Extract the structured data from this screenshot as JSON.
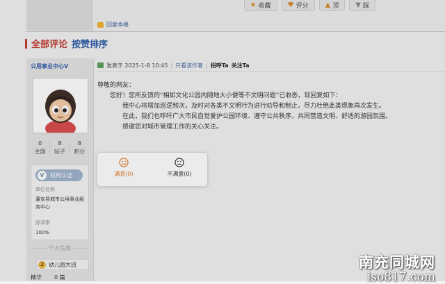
{
  "toolbar": {
    "favorite": "收藏",
    "rate": "评分",
    "up": "顶",
    "down": "踩",
    "reply_this_floor": "回复本楼"
  },
  "section": {
    "all_comments": "全部评论",
    "sort_by_likes": "按赞排序"
  },
  "user": {
    "name": "公用事业中心V",
    "stats": [
      {
        "value": "0",
        "label": "主题"
      },
      {
        "value": "8",
        "label": "帖子"
      },
      {
        "value": "8",
        "label": "积分"
      }
    ],
    "verify_label": "机构认证",
    "unit_name_label": "单位名称",
    "unit_name": "蓬安县城市公用事业服务中心",
    "rating_label": "好评率",
    "rating_value": "100%",
    "info_divider": "个人信息",
    "level": "幼儿园大班",
    "essence_label": "精华",
    "essence_value": "0 篇"
  },
  "post": {
    "published_at": "发表于 2025-1-8 10:45",
    "only_author": "只看该作者",
    "greet": "招呼Ta",
    "follow": "关注Ta",
    "salutation": "尊敬的网友：",
    "lines": [
      "您好！您所反馈的“相如文化公园内随地大小便等不文明问题”已收悉，现回复如下：",
      "我中心将增加巡逻频次，及时对各类不文明行为进行劝导和制止，尽力杜绝此类现象再次发生。",
      "在此，我们也呼吁广大市民自觉爱护公园环境、遵守公共秩序，共同营造文明、舒适的游园氛围。",
      "感谢您对城市管理工作的关心关注。"
    ]
  },
  "rating": {
    "satisfied": "满意(0)",
    "unsatisfied": "不满意(0)"
  },
  "watermark": {
    "cn": "南充同城网",
    "en": "iso817.com"
  },
  "colors": {
    "accent_red": "#c0392b",
    "link_blue": "#2a5aa8",
    "satisfied_orange": "#e07b2a"
  },
  "icons": [
    "star-icon",
    "thumb-icon",
    "arrow-up-icon",
    "arrow-down-icon",
    "reply-icon",
    "verified-icon",
    "smile-icon",
    "frown-icon",
    "post-icon",
    "level-icon"
  ]
}
